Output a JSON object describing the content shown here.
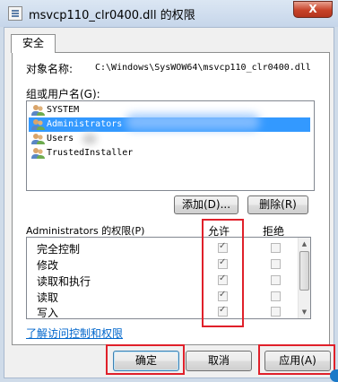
{
  "window": {
    "title": "msvcp110_clr0400.dll 的权限",
    "close_label": "X"
  },
  "tabs": [
    {
      "label": "安全"
    }
  ],
  "object": {
    "label": "对象名称:",
    "path": "C:\\Windows\\SysWOW64\\msvcp110_clr0400.dll"
  },
  "groups": {
    "label": "组或用户名(G):",
    "items": [
      {
        "name": "SYSTEM",
        "selected": false
      },
      {
        "name": "Administrators",
        "selected": true
      },
      {
        "name": "Users",
        "selected": false
      },
      {
        "name": "TrustedInstaller",
        "selected": false
      }
    ],
    "add_label": "添加(D)...",
    "remove_label": "删除(R)"
  },
  "permissions": {
    "label": "Administrators 的权限(P)",
    "allow_header": "允许",
    "deny_header": "拒绝",
    "rows": [
      {
        "name": "完全控制",
        "allow": true,
        "deny": false
      },
      {
        "name": "修改",
        "allow": true,
        "deny": false
      },
      {
        "name": "读取和执行",
        "allow": true,
        "deny": false
      },
      {
        "name": "读取",
        "allow": true,
        "deny": false
      },
      {
        "name": "写入",
        "allow": true,
        "deny": false
      }
    ]
  },
  "link_text": "了解访问控制和权限",
  "buttons": {
    "ok": "确定",
    "cancel": "取消",
    "apply": "应用(A)"
  },
  "colors": {
    "selection": "#3399ff",
    "highlight_box": "#e0202a",
    "link": "#0066cc"
  }
}
